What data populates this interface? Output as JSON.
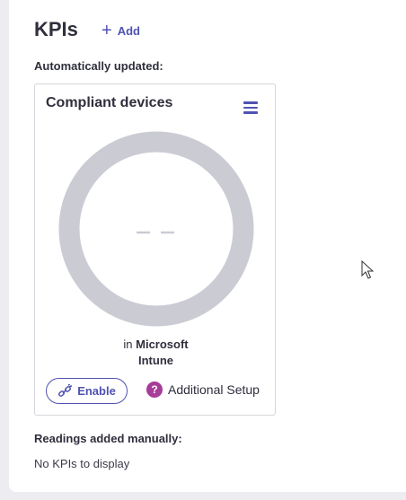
{
  "header": {
    "title": "KPIs",
    "add_label": "Add"
  },
  "auto_section": {
    "label": "Automatically updated:"
  },
  "card": {
    "title": "Compliant devices",
    "value_placeholder": "– –",
    "source_prefix": "in",
    "source_name_line1": "Microsoft",
    "source_name_line2": "Intune",
    "enable_label": "Enable",
    "setup_label": "Additional Setup",
    "setup_icon_glyph": "?"
  },
  "manual_section": {
    "label": "Readings added manually:",
    "empty_text": "No KPIs to display"
  },
  "colors": {
    "accent": "#4f52b2",
    "ring": "#cbcbd4",
    "help": "#a63d97",
    "text": "#2f2f3d"
  }
}
